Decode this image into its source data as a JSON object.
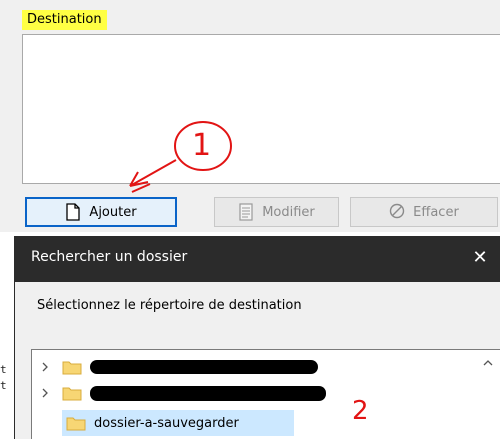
{
  "destination": {
    "group_label": "Destination"
  },
  "buttons": {
    "add": "Ajouter",
    "edit": "Modifier",
    "clear": "Effacer"
  },
  "annotations": {
    "step1": "1",
    "step2": "2"
  },
  "browse_dialog": {
    "title": "Rechercher un dossier",
    "close": "✕",
    "prompt": "Sélectionnez le répertoire de destination",
    "tree": {
      "selected_item": "dossier-a-sauvegarder"
    }
  },
  "terminal_fragments": [
    "t",
    "t"
  ],
  "colors": {
    "highlight": "#ffff44",
    "annotation": "#e21414",
    "selection": "#cce8ff",
    "titlebar": "#2b2b2b",
    "focus_border": "#0a64c8"
  }
}
